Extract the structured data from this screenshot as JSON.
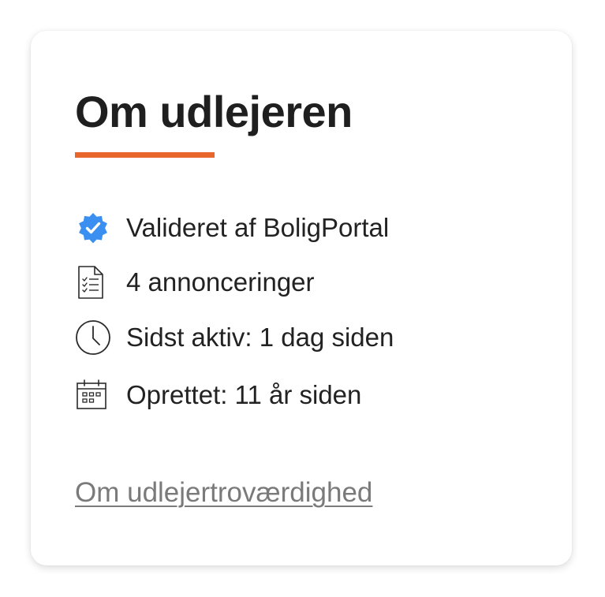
{
  "card": {
    "title": "Om udlejeren",
    "accent_color": "#e8652c",
    "items": [
      {
        "icon": "verified-badge-icon",
        "label": "Valideret af BoligPortal"
      },
      {
        "icon": "document-list-icon",
        "label": "4 annonceringer"
      },
      {
        "icon": "clock-icon",
        "label": "Sidst aktiv: 1 dag siden"
      },
      {
        "icon": "calendar-icon",
        "label": "Oprettet: 11 år siden"
      }
    ],
    "link": "Om udlejertroværdighed"
  },
  "colors": {
    "verified_badge": "#3b8ff0",
    "title_text": "#1f1f1f",
    "link_text": "#7a7a7a"
  }
}
